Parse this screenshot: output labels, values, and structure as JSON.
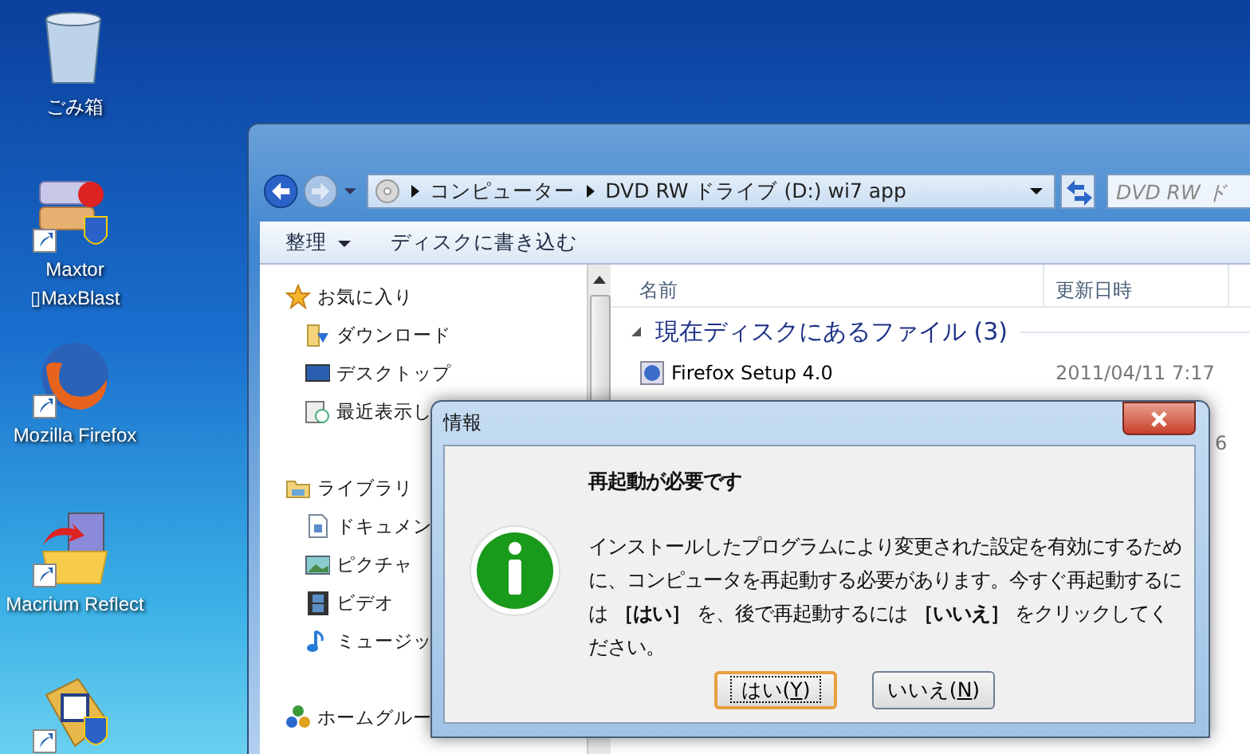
{
  "desktop": {
    "icons": [
      {
        "kind": "trash",
        "label": "ごみ箱"
      },
      {
        "kind": "maxtor",
        "label": "Maxtor ▯MaxBlast"
      },
      {
        "kind": "firefox",
        "label": "Mozilla Firefox"
      },
      {
        "kind": "macrium",
        "label": "Macrium Reflect"
      },
      {
        "kind": "tool"
      }
    ]
  },
  "explorer": {
    "address": {
      "segments": [
        "コンピューター",
        "DVD RW ドライブ (D:) wi7 app"
      ]
    },
    "search": {
      "placeholder": "DVD RW ド"
    },
    "toolbar": [
      {
        "label": "整理",
        "dropdown": true
      },
      {
        "label": "ディスクに書き込む",
        "dropdown": false
      }
    ],
    "nav": [
      {
        "kind": "star",
        "label": "お気に入り",
        "children": [
          {
            "kind": "download",
            "label": "ダウンロード"
          },
          {
            "kind": "desktop",
            "label": "デスクトップ"
          },
          {
            "kind": "recent",
            "label": "最近表示し"
          }
        ]
      },
      {
        "kind": "library",
        "label": "ライブラリ",
        "children": [
          {
            "kind": "document",
            "label": "ドキュメン"
          },
          {
            "kind": "picture",
            "label": "ピクチャ"
          },
          {
            "kind": "video",
            "label": "ビデオ"
          },
          {
            "kind": "music",
            "label": "ミュージッ"
          }
        ]
      },
      {
        "kind": "homegroup",
        "label": "ホームグルー"
      }
    ],
    "columns": [
      "名前",
      "更新日時"
    ],
    "group": "現在ディスクにあるファイル (3)",
    "files": [
      {
        "kind": "file",
        "name": "Firefox Setup 4.0",
        "date": "2011/04/11 7:17"
      },
      {
        "kind": "partial",
        "date": "6"
      }
    ]
  },
  "dialog": {
    "title": "情報",
    "heading": "再起動が必要です",
    "message": "インストールしたプログラムにより変更された設定を有効にするために、コンピュータを再起動する必要があります。今すぐ再起動するには **［はい］** を、後で再起動するには **［いいえ］** をクリックしてください。",
    "buttons": [
      {
        "before": "はい(",
        "key": "Y",
        "after": ")",
        "default": true
      },
      {
        "before": "いいえ(",
        "key": "N",
        "after": ")",
        "default": false
      }
    ]
  }
}
